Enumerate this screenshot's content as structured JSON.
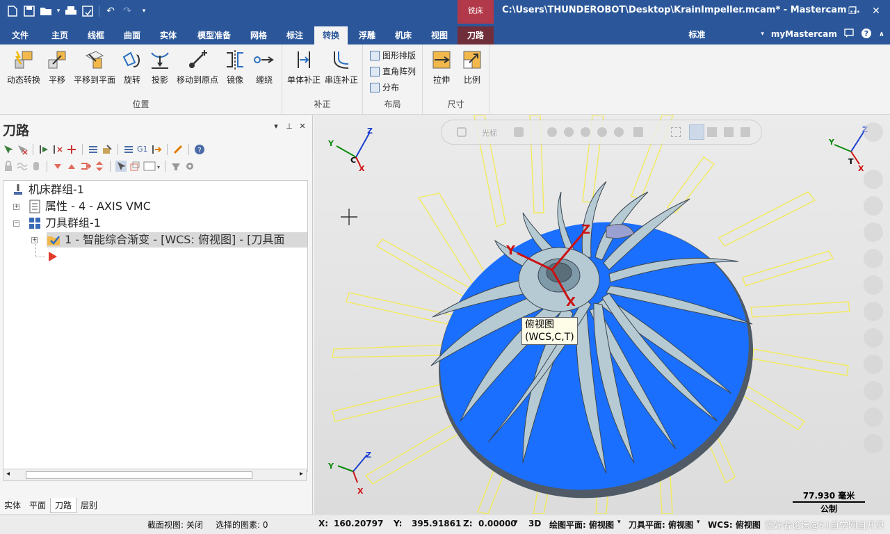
{
  "app": {
    "window_title": "C:\\Users\\THUNDEROBOT\\Desktop\\KrainImpeller.mcam* - Mastercam ...",
    "context_tab_group": "铣床"
  },
  "ribbon_tabs": [
    {
      "label": "文件"
    },
    {
      "label": "主页"
    },
    {
      "label": "线框"
    },
    {
      "label": "曲面"
    },
    {
      "label": "实体"
    },
    {
      "label": "模型准备"
    },
    {
      "label": "网格"
    },
    {
      "label": "标注"
    },
    {
      "label": "转换"
    },
    {
      "label": "浮雕"
    },
    {
      "label": "机床"
    },
    {
      "label": "视图"
    },
    {
      "label": "刀路"
    }
  ],
  "right_tabs": {
    "standard": "标准",
    "mymastercam": "myMastercam"
  },
  "ribbon": {
    "groups": {
      "position": "位置",
      "compensate": "补正",
      "layout": "布局",
      "size": "尺寸"
    },
    "buttons": {
      "dynamic": "动态转换",
      "translate": "平移",
      "translate_plane": "平移到平面",
      "rotate": "旋转",
      "project": "投影",
      "move_origin": "移动到原点",
      "mirror": "镜像",
      "wrap": "缠绕",
      "single_offset": "单体补正",
      "chain_offset": "串连补正",
      "nesting": "图形排版",
      "rect_array": "直角阵列",
      "distribute": "分布",
      "stretch": "拉伸",
      "scale": "比例"
    }
  },
  "panel": {
    "title": "刀路",
    "tree": [
      {
        "label": "机床群组-1"
      },
      {
        "label": "属性 - 4 - AXIS VMC"
      },
      {
        "label": "刀具群组-1"
      },
      {
        "label": "1 - 智能综合渐变 - [WCS: 俯视图] - [刀具面"
      }
    ],
    "bottom_tabs": [
      "实体",
      "平面",
      "刀路",
      "层别"
    ]
  },
  "viewport": {
    "toolbar_label": "光标",
    "tooltip_line1": "俯视图",
    "tooltip_line2": "(WCS,C,T)",
    "scale_value": "77.930 毫米",
    "scale_unit": "公制",
    "axis_labels": {
      "x": "X",
      "y": "Y",
      "z": "Z",
      "c": "C",
      "t": "T"
    },
    "colors": {
      "impeller_base": "#1a6fff",
      "blade": "#b4c8d2",
      "edge": "#ffff66"
    }
  },
  "status": {
    "section_view": "截面视图: 关闭",
    "selected": "选择的图素: 0",
    "x_label": "X:",
    "x_value": "160.20797",
    "y_label": "Y:",
    "y_value": "395.91861",
    "z_label": "Z:",
    "z_value": "0.00000",
    "mode": "3D",
    "cplane": "绘图平面: 俯视图",
    "tplane": "刀具平面: 俯视图",
    "wcs": "WCS: 俯视图",
    "watermark": "爱好者论坛@51自学网自开贝"
  }
}
